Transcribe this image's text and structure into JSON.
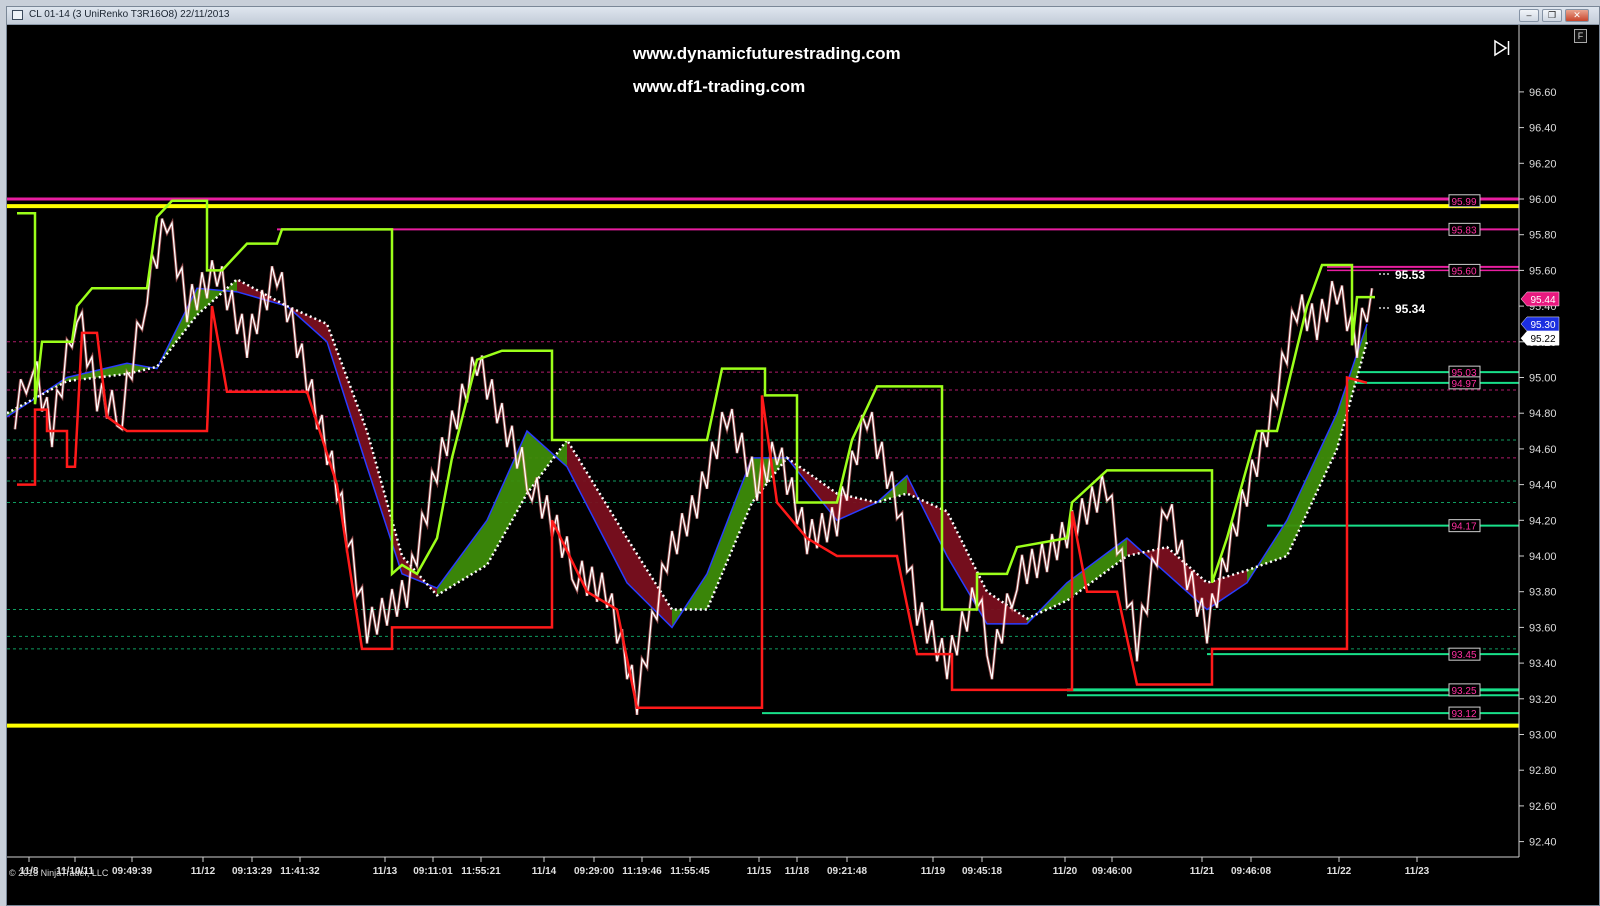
{
  "window": {
    "title": "CL 01-14 (3 UniRenko T3R16O8)  22/11/2013"
  },
  "watermarks": [
    "www.dynamicfuturestrading.com",
    "www.df1-trading.com"
  ],
  "copyright": "© 2013 NinjaTrader, LLC",
  "f_button": "F",
  "price_axis": [
    "96.60",
    "96.40",
    "96.20",
    "96.00",
    "95.80",
    "95.60",
    "95.40",
    "95.20",
    "95.00",
    "94.80",
    "94.60",
    "94.40",
    "94.20",
    "94.00",
    "93.80",
    "93.60",
    "93.40",
    "93.20",
    "93.00",
    "92.80",
    "92.60",
    "92.40"
  ],
  "time_axis": [
    "11/8",
    "11/10/11",
    "09:49:39",
    "11/12",
    "09:13:29",
    "11:41:32",
    "11/13",
    "09:11:01",
    "11:55:21",
    "11/14",
    "09:29:00",
    "11:19:46",
    "11:55:45",
    "11/15",
    "11/18",
    "09:21:48",
    "11/19",
    "09:45:18",
    "11/20",
    "09:46:00",
    "11/21",
    "09:46:08",
    "11/22",
    "11/23"
  ],
  "level_markers": [
    {
      "label": "95.99",
      "color": "#ff2fa0"
    },
    {
      "label": "95.83",
      "color": "#ff2fa0"
    },
    {
      "label": "95.60",
      "color": "#ff2fa0"
    },
    {
      "label": "95.03",
      "color": "#ff2fa0"
    },
    {
      "label": "94.97",
      "color": "#ff2fa0"
    },
    {
      "label": "94.17",
      "color": "#ff2fa0"
    },
    {
      "label": "93.45",
      "color": "#ff2fa0"
    },
    {
      "label": "93.25",
      "color": "#ff2fa0"
    },
    {
      "label": "93.12",
      "color": "#ff2fa0"
    }
  ],
  "price_tags": [
    {
      "label": "95.44",
      "bg": "#e8197f",
      "fg": "#ffffff"
    },
    {
      "label": "95.30",
      "bg": "#1b2ee0",
      "fg": "#ffffff"
    },
    {
      "label": "95.22",
      "bg": "#ffffff",
      "fg": "#000000"
    }
  ],
  "chart_annotations": [
    "95.53",
    "95.34"
  ],
  "colors": {
    "yellow": "#ffff00",
    "magenta": "#e81ea0",
    "lime": "#9cff1a",
    "red": "#ff1a1a",
    "green_band": "#3d8c0a",
    "maroon_band": "#7a0f1f",
    "teal": "#18e08a"
  }
}
